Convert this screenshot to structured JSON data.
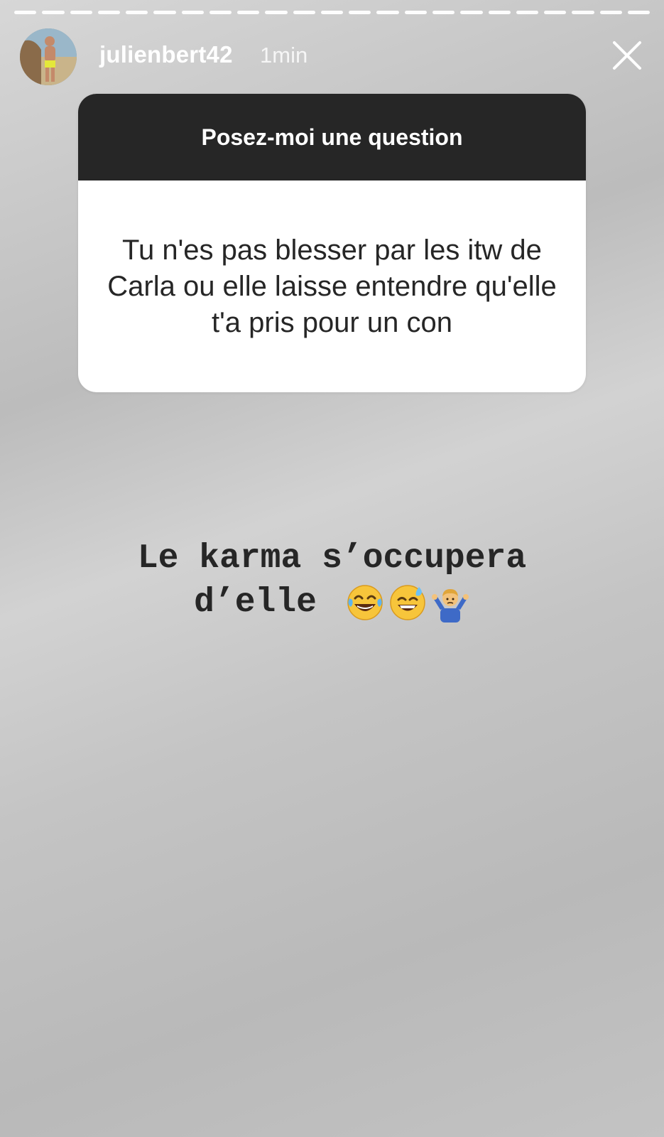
{
  "story": {
    "progress_segments": 23,
    "username": "julienbert42",
    "time": "1min"
  },
  "question_card": {
    "header": "Posez-moi une question",
    "question": "Tu n'es pas blesser par les itw de Carla ou elle laisse entendre qu'elle t'a pris pour un con"
  },
  "answer": {
    "line1": "Le karma s’occupera",
    "line2": "d’elle",
    "emojis": [
      "face-with-tears-of-joy-icon",
      "grinning-face-with-sweat-icon",
      "man-shrugging-icon"
    ]
  },
  "colors": {
    "card_header_bg": "#262626",
    "card_body_bg": "#ffffff",
    "text_dark": "#262626"
  }
}
